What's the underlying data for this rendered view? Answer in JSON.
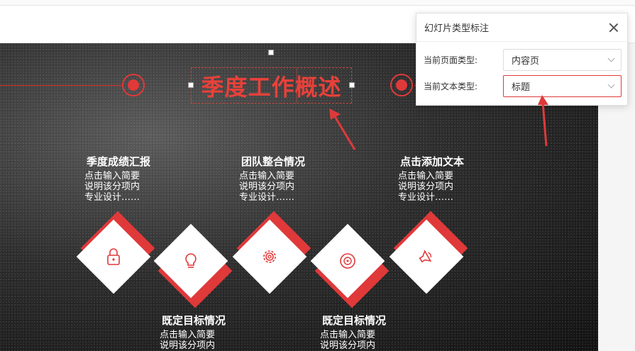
{
  "slide": {
    "title": "季度工作概述",
    "blocks": [
      {
        "title": "季度成绩汇报",
        "lines": [
          "点击输入简要",
          "说明该分项内",
          "专业设计……"
        ]
      },
      {
        "title": "团队整合情况",
        "lines": [
          "点击输入简要",
          "说明该分项内",
          "专业设计……"
        ]
      },
      {
        "title": "点击添加文本",
        "lines": [
          "点击输入简要",
          "说明该分项内",
          "专业设计……"
        ]
      },
      {
        "title": "既定目标情况",
        "lines": [
          "点击输入简要",
          "说明该分项内"
        ]
      },
      {
        "title": "既定目标情况",
        "lines": [
          "点击输入简要",
          "说明该分项内"
        ]
      }
    ],
    "diamond_icons": [
      "lock-icon",
      "lightbulb-icon",
      "gear-icon",
      "disc-icon",
      "speaker-icon"
    ],
    "accent_color": "#e0393a"
  },
  "panel": {
    "title": "幻灯片类型标注",
    "page_type_label": "当前页面类型:",
    "page_type_value": "内容页",
    "text_type_label": "当前文本类型:",
    "text_type_value": "标题"
  }
}
